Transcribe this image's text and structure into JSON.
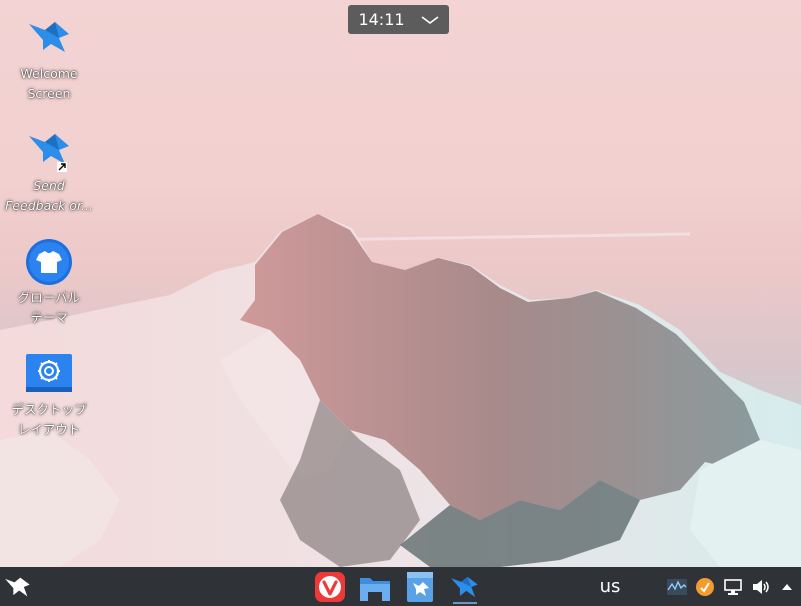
{
  "clock": {
    "time": "14:11"
  },
  "desktop_icons": [
    {
      "label": "Welcome\nScreen",
      "icon": "kde-bird-icon"
    },
    {
      "label": "Send\nFeedback or...",
      "icon": "kde-bird-link-icon"
    },
    {
      "label": "グローバル\nテーマ",
      "icon": "tshirt-theme-icon"
    },
    {
      "label": "デスクトップ\nレイアウト",
      "icon": "desktop-layout-icon"
    }
  ],
  "taskbar": {
    "launcher_icon": "kde-bird-launcher-icon",
    "pinned_apps": [
      "vivaldi-icon",
      "file-manager-icon",
      "software-center-icon",
      "welcome-bird-icon"
    ],
    "keyboard_layout": "us",
    "tray_icons": [
      "system-monitor-icon",
      "update-notifier-icon",
      "network-icon",
      "volume-icon",
      "tray-expand-icon"
    ]
  },
  "colors": {
    "panel": "#2f3338",
    "clock_bg": "#5c5c5c",
    "bird_blue": "#2c8ee8",
    "vivaldi_red": "#ef3939"
  }
}
